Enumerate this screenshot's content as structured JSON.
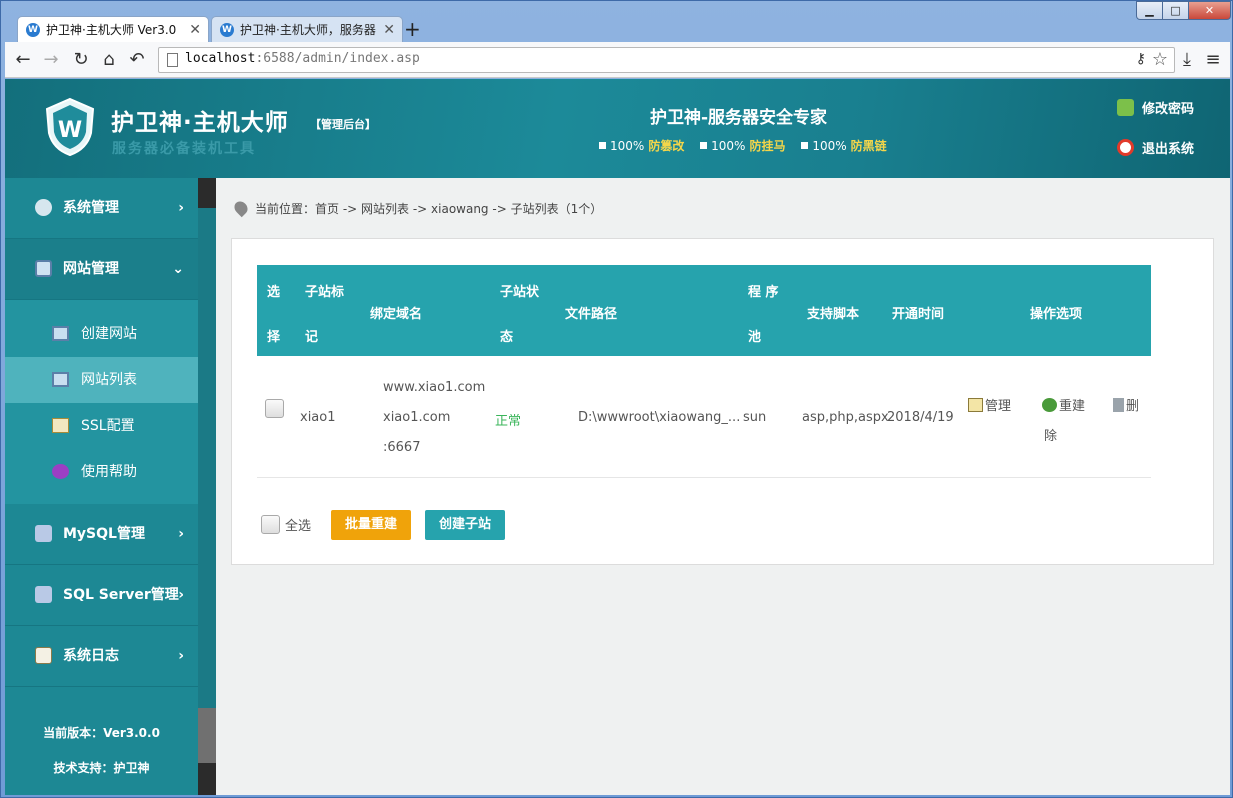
{
  "browser": {
    "tabs": [
      {
        "label": "护卫神·主机大师 Ver3.0"
      },
      {
        "label": "护卫神·主机大师，服务器"
      }
    ],
    "url_host": "localhost",
    "url_rest": ":6588/admin/index.asp",
    "window_buttons": {
      "min": "0",
      "max": "1",
      "close": "r"
    }
  },
  "header": {
    "brand": "护卫神·主机大师",
    "brand_tag": "【管理后台】",
    "brand_sub": "服务器必备装机工具",
    "center_title": "护卫神-服务器安全专家",
    "stats": [
      {
        "pct": "100%",
        "label": "防篡改"
      },
      {
        "pct": "100%",
        "label": "防挂马"
      },
      {
        "pct": "100%",
        "label": "防黑链"
      }
    ],
    "change_password": "修改密码",
    "logout": "退出系统"
  },
  "sidebar": {
    "menu": [
      {
        "label": "系统管理"
      },
      {
        "label": "网站管理"
      },
      {
        "label": "MySQL管理"
      },
      {
        "label": "SQL Server管理"
      },
      {
        "label": "系统日志"
      }
    ],
    "sub": [
      {
        "label": "创建网站"
      },
      {
        "label": "网站列表"
      },
      {
        "label": "SSL配置"
      },
      {
        "label": "使用帮助"
      }
    ],
    "version": "当前版本：Ver3.0.0",
    "support": "技术支持：护卫神"
  },
  "breadcrumb": "当前位置：首页 -> 网站列表 -> xiaowang -> 子站列表（1个）",
  "table": {
    "headers": {
      "select_1": "选",
      "select_2": "择",
      "tag_1": "子站标",
      "tag_2": "记",
      "domain": "绑定域名",
      "status_1": "子站状",
      "status_2": "态",
      "path": "文件路径",
      "pool_1": "程 序",
      "pool_2": "池",
      "script": "支持脚本",
      "opened": "开通时间",
      "ops": "操作选项"
    },
    "rows": [
      {
        "tag": "xiao1",
        "domain_1": "www.xiao1.com",
        "domain_2": "xiao1.com",
        "domain_3": ":6667",
        "status": "正常",
        "path": "D:\\wwwroot\\xiaowang_...",
        "pool": "sun",
        "script": "asp,php,aspx",
        "opened": "2018/4/19",
        "op_manage": "管理",
        "op_rebuild": "重建",
        "op_delete_1": "删",
        "op_delete_2": "除"
      }
    ]
  },
  "footer_actions": {
    "select_all": "全选",
    "batch_rebuild": "批量重建",
    "create_sub": "创建子站"
  },
  "colors": {
    "header_teal": "#1c8a99",
    "sidebar_teal": "#1d8894",
    "table_head": "#26a3ad",
    "btn_orange": "#f0a30a",
    "status_green": "#3ab55a"
  }
}
